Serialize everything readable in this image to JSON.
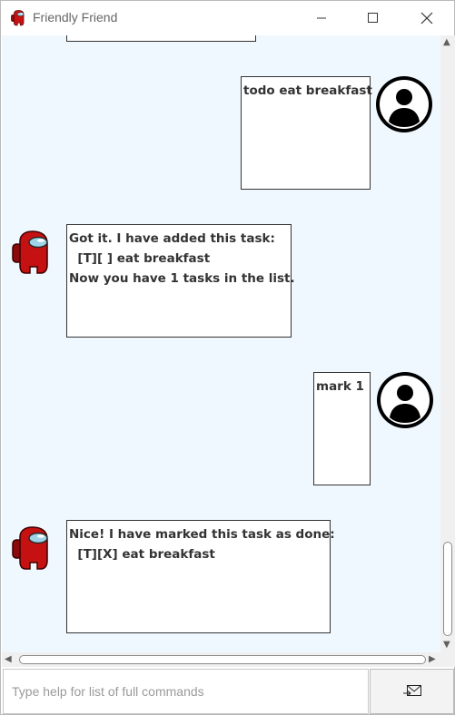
{
  "window": {
    "title": "Friendly Friend"
  },
  "messages": [
    {
      "sender": "user",
      "text": "todo eat breakfast"
    },
    {
      "sender": "bot",
      "text": "Got it. I have added this task:\n  [T][ ] eat breakfast\nNow you have 1 tasks in the list."
    },
    {
      "sender": "user",
      "text": "mark 1"
    },
    {
      "sender": "bot",
      "text": "Nice! I have marked this task as done:\n  [T][X] eat breakfast"
    }
  ],
  "input": {
    "placeholder": "Type help for list of full commands",
    "value": ""
  },
  "icons": {
    "app": "crewmate-icon",
    "minimize": "minimize-icon",
    "maximize": "maximize-icon",
    "close": "close-icon",
    "user_avatar": "user-avatar-icon",
    "bot_avatar": "crewmate-avatar-icon",
    "send": "send-mail-icon"
  },
  "colors": {
    "chat_background": "#f0f8ff",
    "bubble_border": "#333333",
    "crewmate": "#c51111"
  }
}
